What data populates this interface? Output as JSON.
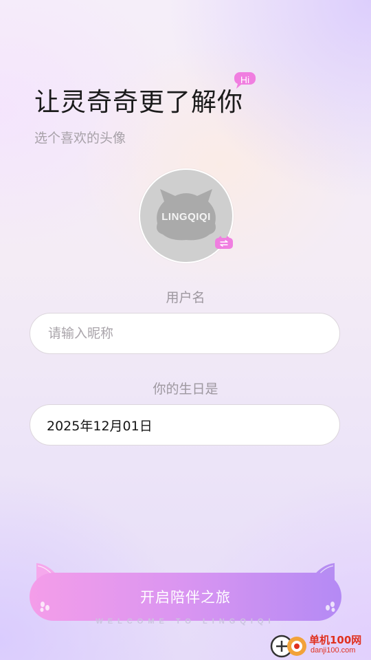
{
  "header": {
    "title": "让灵奇奇更了解你",
    "hi_badge": "Hi",
    "subtitle": "选个喜欢的头像"
  },
  "avatar": {
    "text": "LINGQIQI",
    "badge_icon": "swap-icon"
  },
  "username": {
    "label": "用户名",
    "placeholder": "请输入昵称",
    "value": ""
  },
  "birthday": {
    "label": "你的生日是",
    "value": "2025年12月01日"
  },
  "start_button": {
    "label": "开启陪伴之旅",
    "tagline": "WELCOME TO LINGQIQI"
  },
  "watermark": {
    "title": "单机100网",
    "url": "danji100.com"
  },
  "colors": {
    "accent_pink": "#f49de9",
    "accent_purple": "#b48af4",
    "hi_badge": "#f07ee0"
  }
}
